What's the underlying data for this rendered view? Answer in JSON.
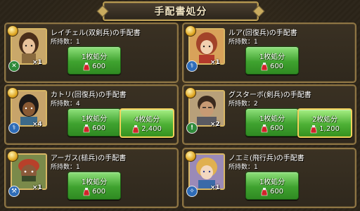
{
  "header": {
    "title": "手配書処分"
  },
  "colors": {
    "button_green": "#3fa22f",
    "frame_gold": "#8e7544",
    "highlight_border": "#f2d15a"
  },
  "cards": [
    {
      "name": "レイチェル(双剣兵)の手配書",
      "owned": "所持数：1",
      "multiplier": "×1",
      "class_icon": "crossed-swords-icon",
      "buttons": [
        {
          "label": "1枚処分",
          "value": "600",
          "icon": "potion-icon"
        }
      ]
    },
    {
      "name": "ルア(回復兵)の手配書",
      "owned": "所持数：1",
      "multiplier": "×1",
      "class_icon": "staff-icon",
      "buttons": [
        {
          "label": "1枚処分",
          "value": "600",
          "icon": "potion-icon"
        }
      ]
    },
    {
      "name": "カトリ(回復兵)の手配書",
      "owned": "所持数：4",
      "multiplier": "×4",
      "class_icon": "staff-icon",
      "buttons": [
        {
          "label": "1枚処分",
          "value": "600",
          "icon": "potion-icon"
        },
        {
          "label": "4枚処分",
          "value": "2,400",
          "icon": "potion-icon"
        }
      ]
    },
    {
      "name": "グスターボ(剣兵)の手配書",
      "owned": "所持数：2",
      "multiplier": "×2",
      "class_icon": "sword-icon",
      "buttons": [
        {
          "label": "1枚処分",
          "value": "600",
          "icon": "potion-icon"
        },
        {
          "label": "2枚処分",
          "value": "1,200",
          "icon": "potion-icon"
        }
      ]
    },
    {
      "name": "アーガス(槌兵)の手配書",
      "owned": "所持数：1",
      "multiplier": "×1",
      "class_icon": "hammer-icon",
      "buttons": [
        {
          "label": "1枚処分",
          "value": "600",
          "icon": "potion-icon"
        }
      ]
    },
    {
      "name": "ノエミ(飛行兵)の手配書",
      "owned": "所持数：1",
      "multiplier": "×1",
      "class_icon": "wing-icon",
      "buttons": [
        {
          "label": "1枚処分",
          "value": "600",
          "icon": "potion-icon"
        }
      ]
    }
  ]
}
